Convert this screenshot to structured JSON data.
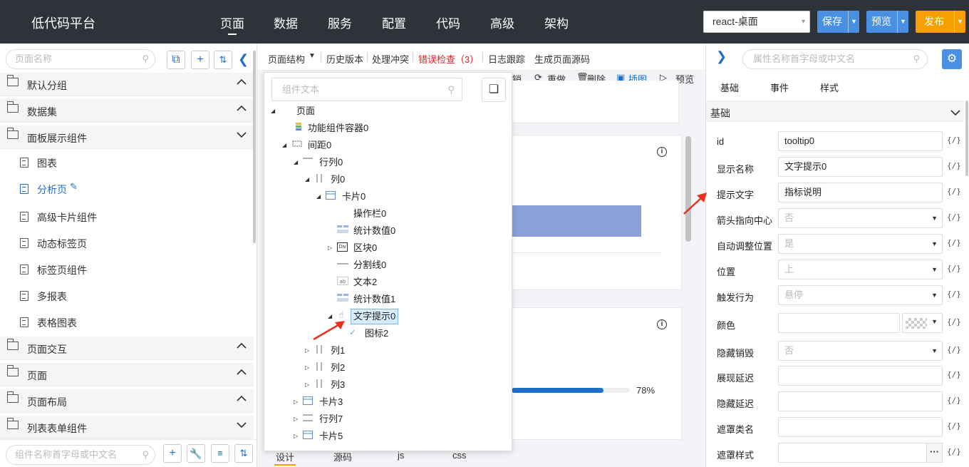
{
  "app": {
    "title": "低代码平台",
    "nav": [
      "页面",
      "数据",
      "服务",
      "配置",
      "代码",
      "高级",
      "架构"
    ],
    "env": "react-桌面",
    "save": "保存",
    "preview": "预览",
    "publish": "发布",
    "colors": {
      "topbar": "#2d3339",
      "save": "#4a90e2",
      "publish": "#f5a000",
      "accent": "#1f6fc8"
    }
  },
  "left": {
    "search_placeholder": "页面名称",
    "groups_top": [
      "默认分组",
      "数据集",
      "面板展示组件"
    ],
    "items": [
      "图表",
      "分析页",
      "高级卡片组件",
      "动态标签页",
      "标签页组件",
      "多报表",
      "表格图表"
    ],
    "active_item": "分析页",
    "groups_bottom": [
      "页面交互",
      "页面",
      "页面布局",
      "列表表单组件"
    ],
    "component_search_placeholder": "组件名称首字母或中文名"
  },
  "center": {
    "toolbar": [
      "页面结构",
      "历史版本",
      "处理冲突",
      "错误检查（3）",
      "日志跟踪",
      "生成页面源码"
    ],
    "subtoolbar": [
      "销",
      "重做",
      "删除",
      "插图",
      "预览"
    ],
    "progress_label": "78%",
    "progress_value": 78,
    "bottom_tabs": [
      "设计",
      "源码",
      "js",
      "css"
    ]
  },
  "tree": {
    "search_placeholder": "组件文本",
    "nodes": {
      "n0": "页面",
      "n1": "功能组件容器0",
      "n2": "间距0",
      "n3": "行列0",
      "n4": "列0",
      "n5": "卡片0",
      "n6": "操作栏0",
      "n7": "统计数值0",
      "n8": "区块0",
      "n9": "分割线0",
      "n10": "文本2",
      "n11": "统计数值1",
      "n12": "文字提示0",
      "n13": "图标2",
      "n14": "列1",
      "n15": "列2",
      "n16": "列3",
      "n17": "卡片3",
      "n18": "行列7",
      "n19": "卡片5"
    },
    "div_badge": "Div"
  },
  "right": {
    "search_placeholder": "属性名称首字母或中文名",
    "tabs": [
      "基础",
      "事件",
      "样式"
    ],
    "section": "基础",
    "code_btn": "{/}",
    "rows": [
      {
        "label": "id",
        "value": "tooltip0"
      },
      {
        "label": "显示名称",
        "value": "文字提示0"
      },
      {
        "label": "提示文字",
        "value": "指标说明"
      },
      {
        "label": "箭头指向中心",
        "value": "否"
      },
      {
        "label": "自动调整位置",
        "value": "是"
      },
      {
        "label": "位置",
        "value": "上"
      },
      {
        "label": "触发行为",
        "value": "悬停"
      },
      {
        "label": "颜色",
        "value": ""
      },
      {
        "label": "隐藏销毁",
        "value": "否"
      },
      {
        "label": "展现延迟",
        "value": ""
      },
      {
        "label": "隐藏延迟",
        "value": ""
      },
      {
        "label": "遮罩类名",
        "value": ""
      },
      {
        "label": "遮罩样式",
        "value": ""
      }
    ]
  }
}
